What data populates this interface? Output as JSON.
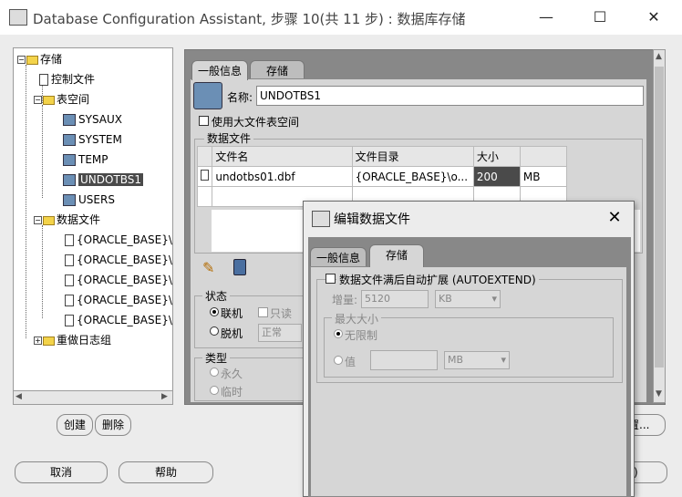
{
  "window": {
    "title": "Database Configuration Assistant, 步骤 10(共 11 步) : 数据库存储",
    "minimize": "—",
    "maximize": "☐",
    "close": "✕"
  },
  "tree": {
    "root": "存储",
    "control_files": "控制文件",
    "tablespaces": "表空间",
    "ts_items": [
      "SYSAUX",
      "SYSTEM",
      "TEMP",
      "UNDOTBS1",
      "USERS"
    ],
    "datafiles": "数据文件",
    "df_items": [
      "{ORACLE_BASE}\\o",
      "{ORACLE_BASE}\\o",
      "{ORACLE_BASE}\\o",
      "{ORACLE_BASE}\\o",
      "{ORACLE_BASE}\\o"
    ],
    "redo": "重做日志组"
  },
  "tree_buttons": {
    "create": "创建",
    "delete": "删除"
  },
  "tabs": {
    "general": "一般信息",
    "storage": "存储"
  },
  "general": {
    "name_label": "名称:",
    "name_value": "UNDOTBS1",
    "bigfile_label": "使用大文件表空间",
    "datafile_section": "数据文件",
    "columns": [
      "文件名",
      "文件目录",
      "大小",
      ""
    ],
    "rows": [
      [
        "undotbs01.dbf",
        "{ORACLE_BASE}\\o...",
        "200",
        "MB"
      ]
    ],
    "status_label": "状态",
    "online": "联机",
    "readonly": "只读",
    "offline": "脱机",
    "offline_mode": "正常",
    "type_label": "类型",
    "permanent": "永久",
    "temporary": "临时"
  },
  "footer": {
    "cancel": "取消",
    "help": "帮助",
    "right_btn_partial": "置...",
    "right_btn2_partial": ")"
  },
  "dialog": {
    "title": "编辑数据文件",
    "close": "✕",
    "tabs": {
      "general": "一般信息",
      "storage": "存储"
    },
    "autoextend_label": "数据文件满后自动扩展 (AUTOEXTEND)",
    "increment_label": "增量:",
    "increment_value": "5120",
    "increment_unit": "KB",
    "maxsize_label": "最大大小",
    "unlimited": "无限制",
    "value": "值",
    "value_unit": "MB"
  }
}
